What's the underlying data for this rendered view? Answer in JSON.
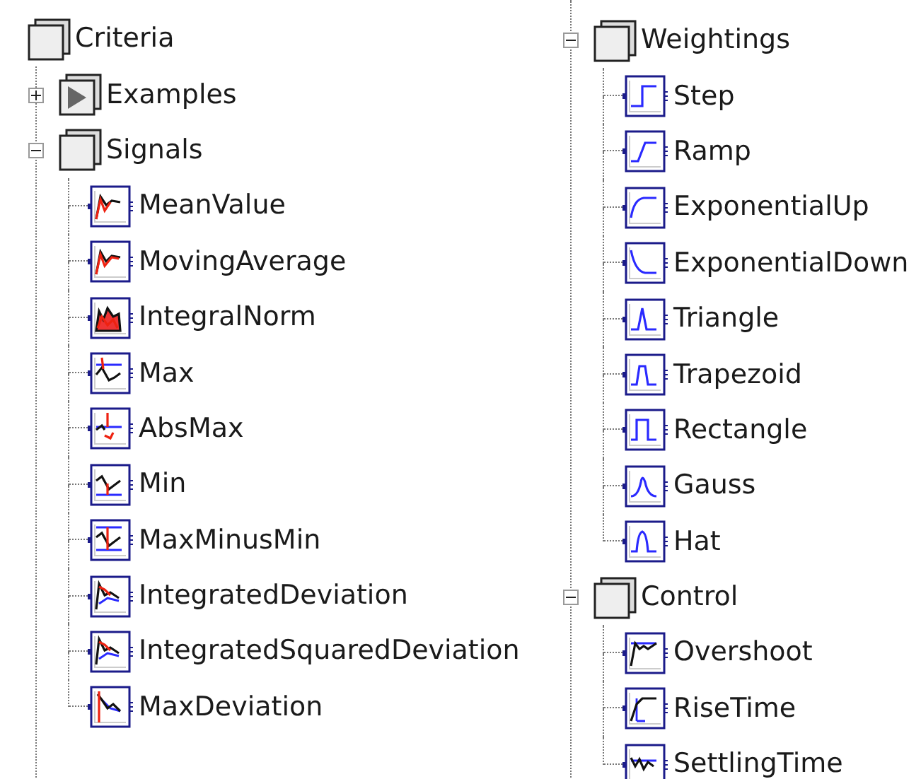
{
  "tree": {
    "root": {
      "label": "Criteria",
      "children": [
        {
          "kind": "examples",
          "label": "Examples",
          "expanded": false
        },
        {
          "kind": "signals",
          "label": "Signals",
          "expanded": true,
          "children": [
            {
              "label": "MeanValue"
            },
            {
              "label": "MovingAverage"
            },
            {
              "label": "IntegralNorm"
            },
            {
              "label": "Max"
            },
            {
              "label": "AbsMax"
            },
            {
              "label": "Min"
            },
            {
              "label": "MaxMinusMin"
            },
            {
              "label": "IntegratedDeviation"
            },
            {
              "label": "IntegratedSquaredDeviation"
            },
            {
              "label": "MaxDeviation"
            }
          ]
        },
        {
          "kind": "weightings",
          "label": "Weightings",
          "expanded": true,
          "children": [
            {
              "label": "Step"
            },
            {
              "label": "Ramp"
            },
            {
              "label": "ExponentialUp"
            },
            {
              "label": "ExponentialDown"
            },
            {
              "label": "Triangle"
            },
            {
              "label": "Trapezoid"
            },
            {
              "label": "Rectangle"
            },
            {
              "label": "Gauss"
            },
            {
              "label": "Hat"
            }
          ]
        },
        {
          "kind": "control",
          "label": "Control",
          "expanded": true,
          "children": [
            {
              "label": "Overshoot"
            },
            {
              "label": "RiseTime"
            },
            {
              "label": "SettlingTime"
            }
          ]
        }
      ]
    }
  }
}
